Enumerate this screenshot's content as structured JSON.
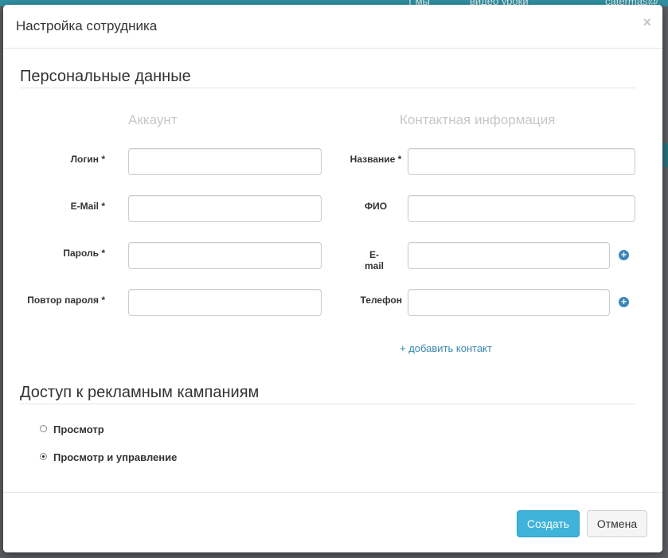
{
  "background": {
    "top_texts": [
      "т мы",
      "видео уроки",
      "catermas@"
    ]
  },
  "modal": {
    "title": "Настройка сотрудника",
    "close_label": "×",
    "personal": {
      "title": "Персональные данные",
      "account_heading": "Аккаунт",
      "contact_heading": "Контактная информация",
      "account_fields": [
        {
          "label": "Логин *",
          "value": ""
        },
        {
          "label": "E-Mail *",
          "value": ""
        },
        {
          "label": "Пароль *",
          "value": ""
        },
        {
          "label": "Повтор пароля *",
          "value": ""
        }
      ],
      "contact_fields": [
        {
          "label": "Название *",
          "value": ""
        },
        {
          "label": "ФИО",
          "value": ""
        },
        {
          "label": "E-mail",
          "value": ""
        },
        {
          "label": "Телефон",
          "value": ""
        }
      ],
      "plus_label": "+",
      "add_contact": "+ добавить контакт"
    },
    "access": {
      "title": "Доступ к рекламным кампаниям",
      "options": [
        {
          "label": "Просмотр",
          "checked": false
        },
        {
          "label": "Просмотр и управление",
          "checked": true
        }
      ]
    },
    "footer": {
      "create_label": "Создать",
      "cancel_label": "Отмена"
    },
    "colors": {
      "primary": "#3fb3d9",
      "link": "#3a87ad",
      "plus_icon": "#3b86bd"
    }
  }
}
